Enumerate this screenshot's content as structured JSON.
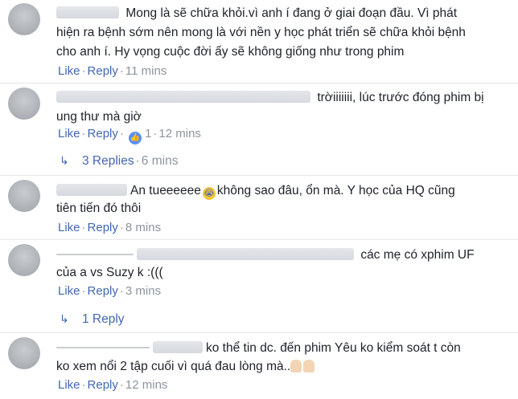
{
  "comments": [
    {
      "lines": [
        "Mong là sẽ chữa khỏi.vì anh í đang ở giai đoạn đầu. Vì phát",
        "hiện ra bệnh sớm nên mong là với nền y học phát triển sẽ chữa khỏi bệnh",
        "cho anh í. Hy vọng cuộc đời ấy sẽ không giống như trong phim"
      ],
      "like": "Like",
      "reply": "Reply",
      "time": "11 mins"
    },
    {
      "lines": [
        "trờiiiiiii, lúc trước đóng phim bị",
        "ung thư mà giờ"
      ],
      "like": "Like",
      "reply": "Reply",
      "reaction_count": "1",
      "time": "12 mins",
      "replies_link": "3 Replies",
      "replies_time": "6 mins"
    },
    {
      "lines": [
        "An tueeeeee",
        "không sao đâu, ổn mà. Y học của HQ cũng",
        "tiên tiến đó thôi"
      ],
      "like": "Like",
      "reply": "Reply",
      "time": "8 mins"
    },
    {
      "lines": [
        "các mẹ có xphim UF",
        "của a vs Suzy k :((("
      ],
      "like": "Like",
      "reply": "Reply",
      "time": "3 mins",
      "replies_link": "1 Reply"
    },
    {
      "lines": [
        "ko thể tin dc. đến phim Yêu ko kiểm soát t còn",
        "ko xem nổi 2 tập cuối vì quá đau lòng mà.."
      ],
      "like": "Like",
      "reply": "Reply",
      "time": "12 mins"
    }
  ],
  "colors": {
    "link": "#4267b2",
    "meta": "#8d949e",
    "text": "#1d2129",
    "divider": "#e5e6e9"
  },
  "icons": [
    "like-reaction-icon",
    "reply-arrow-icon",
    "crying-emoji-icon",
    "praying-hands-icon"
  ]
}
